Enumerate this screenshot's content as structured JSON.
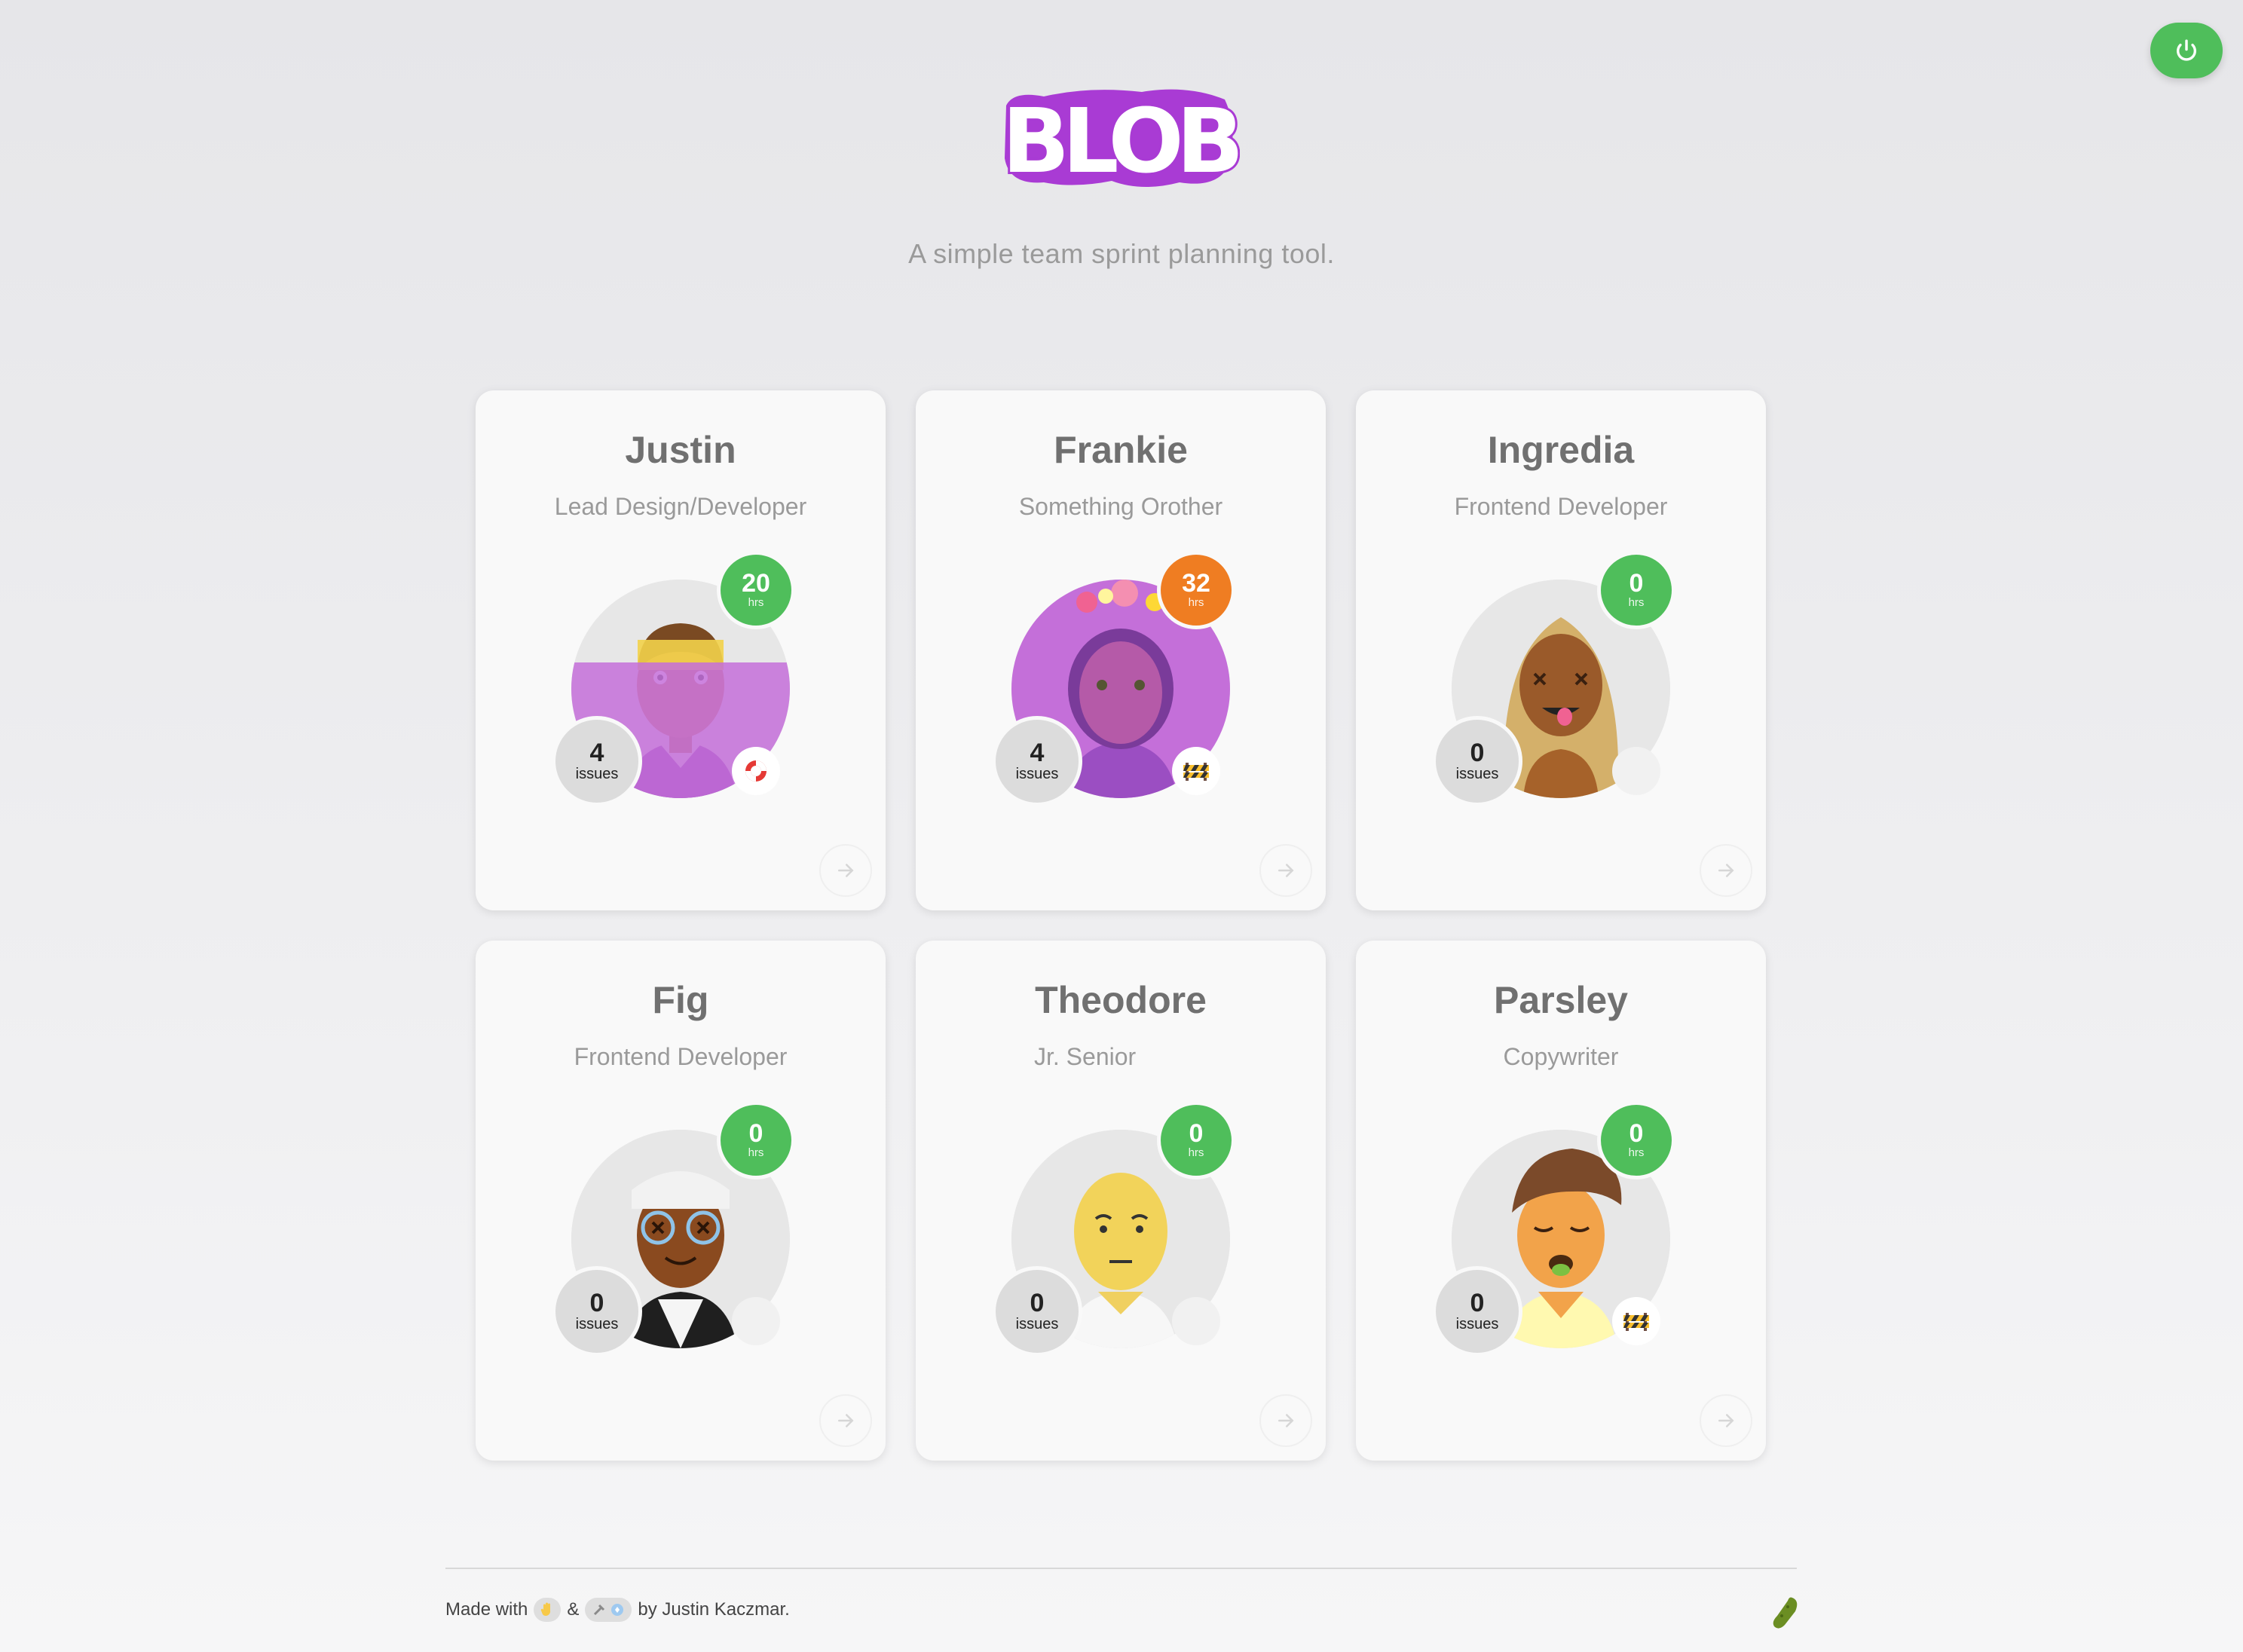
{
  "app": {
    "logo_text": "BLOB",
    "tagline": "A simple team sprint planning tool.",
    "brand_color": "#a93bd4"
  },
  "header": {
    "power_icon": "power-icon"
  },
  "members": [
    {
      "name": "Justin",
      "role": "Lead Design/Developer",
      "hrs": "20",
      "hrs_unit": "hrs",
      "hrs_color": "green",
      "issues": "4",
      "issues_unit": "issues",
      "status_icon": "lifebuoy-icon"
    },
    {
      "name": "Frankie",
      "role": "Something Orother",
      "hrs": "32",
      "hrs_unit": "hrs",
      "hrs_color": "orange",
      "issues": "4",
      "issues_unit": "issues",
      "status_icon": "construction-barrier-icon"
    },
    {
      "name": "Ingredia",
      "role": "Frontend Developer",
      "hrs": "0",
      "hrs_unit": "hrs",
      "hrs_color": "green",
      "issues": "0",
      "issues_unit": "issues",
      "status_icon": ""
    },
    {
      "name": "Fig",
      "role": "Frontend Developer",
      "hrs": "0",
      "hrs_unit": "hrs",
      "hrs_color": "green",
      "issues": "0",
      "issues_unit": "issues",
      "status_icon": ""
    },
    {
      "name": "Theodore",
      "role": "Jr. Senior",
      "hrs": "0",
      "hrs_unit": "hrs",
      "hrs_color": "green",
      "issues": "0",
      "issues_unit": "issues",
      "status_icon": ""
    },
    {
      "name": "Parsley",
      "role": "Copywriter",
      "hrs": "0",
      "hrs_unit": "hrs",
      "hrs_color": "green",
      "issues": "0",
      "issues_unit": "issues",
      "status_icon": "construction-barrier-icon"
    }
  ],
  "footer": {
    "made_with": "Made with",
    "amp": "&",
    "by": "by Justin Kaczmar."
  },
  "colors": {
    "green": "#4fbe5b",
    "orange": "#ef7d22",
    "purple_overlay": "#c46fd9"
  }
}
